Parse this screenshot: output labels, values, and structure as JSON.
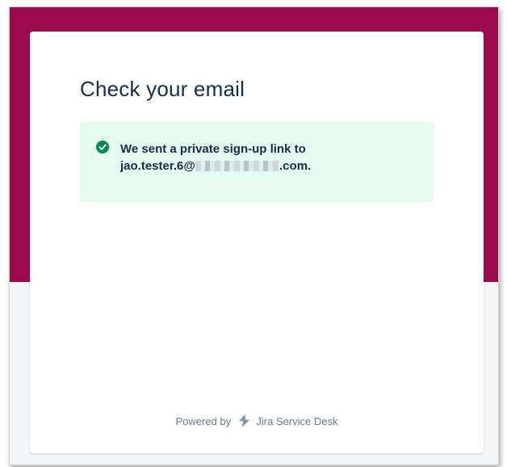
{
  "page": {
    "title": "Check your email"
  },
  "notice": {
    "line1": "We sent a private sign-up link to",
    "email_prefix": "jao.tester.6@",
    "email_suffix": ".com."
  },
  "footer": {
    "powered_by": "Powered by",
    "product": "Jira Service Desk"
  },
  "icons": {
    "status": "check-circle-icon",
    "brand": "jira-service-desk-logo-icon"
  },
  "colors": {
    "banner": "#9b0a4d",
    "success_bg": "#e3fcef",
    "success_icon": "#00875a",
    "text": "#172b4d",
    "muted": "#6b778c"
  }
}
